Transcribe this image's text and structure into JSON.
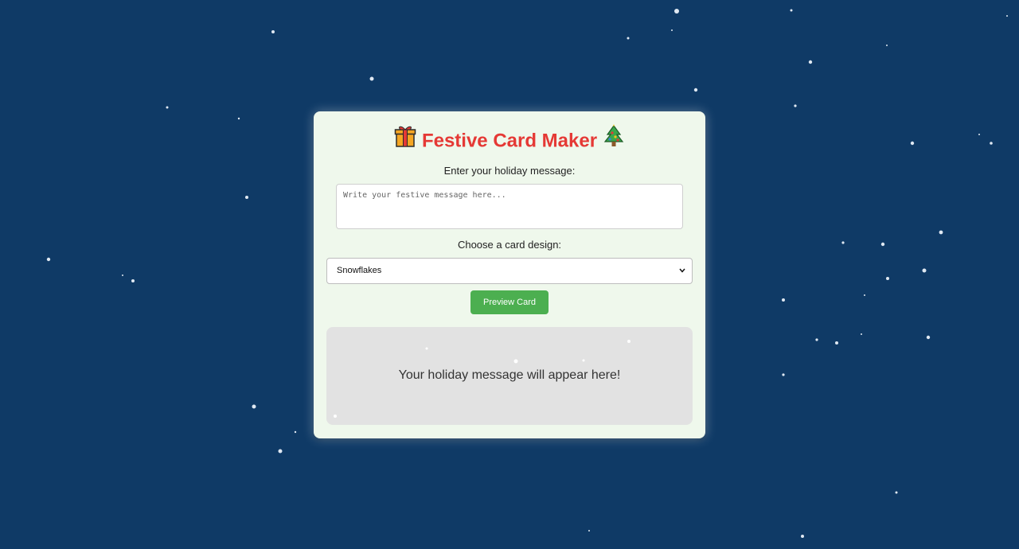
{
  "page": {
    "background": "#0f3a66",
    "card_background": "#eff8ec"
  },
  "header": {
    "title": "Festive Card Maker",
    "left_icon": "gift-icon",
    "right_icon": "christmas-tree-icon",
    "title_color": "#e53935"
  },
  "message": {
    "label": "Enter your holiday message:",
    "placeholder": "Write your festive message here...",
    "value": ""
  },
  "design": {
    "label": "Choose a card design:",
    "selected": "Snowflakes"
  },
  "preview_button": {
    "label": "Preview Card",
    "color": "#4caf50"
  },
  "preview": {
    "text": "Your holiday message will appear here!"
  }
}
